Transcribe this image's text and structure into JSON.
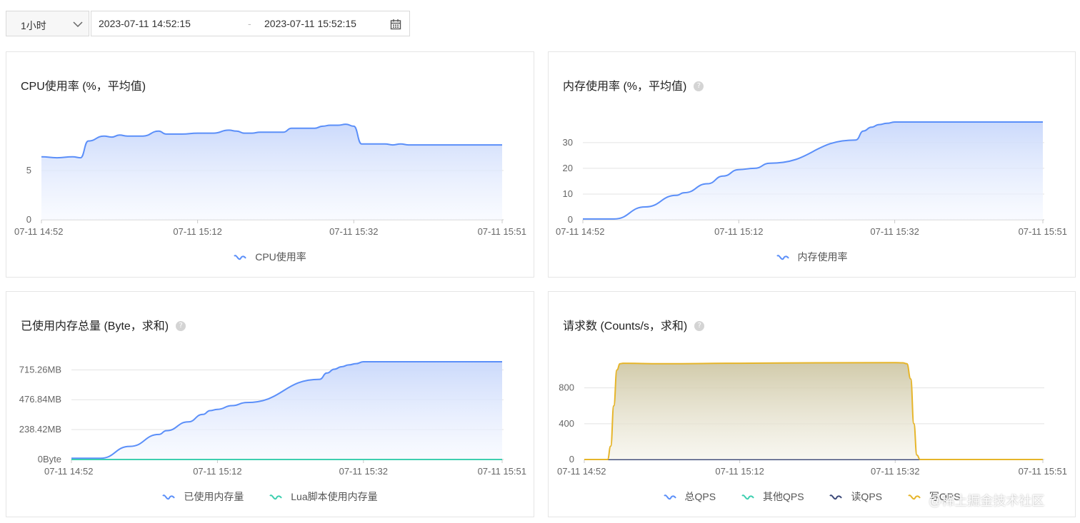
{
  "toolbar": {
    "range_select": {
      "value": "1小时"
    },
    "start_time": "2023-07-11 14:52:15",
    "separator": "-",
    "end_time": "2023-07-11 15:52:15"
  },
  "colors": {
    "blue": "#5b8ff9",
    "teal": "#3ecfb0",
    "navy": "#3d4a7a",
    "gold": "#e6b52a",
    "grid": "#e3e3e3",
    "axis": "#c8c8c8"
  },
  "panels": {
    "cpu": {
      "title": "CPU使用率 (%，平均值)",
      "legend": [
        "CPU使用率"
      ]
    },
    "mem": {
      "title": "内存使用率 (%，平均值)",
      "legend": [
        "内存使用率"
      ]
    },
    "used": {
      "title": "已使用内存总量 (Byte，求和)",
      "legend": [
        "已使用内存量",
        "Lua脚本使用内存量"
      ]
    },
    "qps": {
      "title": "请求数 (Counts/s，求和)",
      "legend": [
        "总QPS",
        "其他QPS",
        "读QPS",
        "写QPS"
      ]
    }
  },
  "chart_data": [
    {
      "id": "cpu",
      "type": "area",
      "x_ticks": [
        "07-11 14:52",
        "07-11 15:12",
        "07-11 15:32",
        "07-11 15:51"
      ],
      "y_ticks": [
        0,
        5
      ],
      "ylim": [
        0,
        10
      ],
      "series": [
        {
          "name": "CPU使用率",
          "x": [
            0,
            2,
            4,
            5,
            6,
            8,
            9,
            10,
            11,
            12,
            13,
            15,
            16,
            17,
            18,
            20,
            22,
            24,
            25,
            26,
            27,
            28,
            29,
            30,
            31,
            32,
            33,
            34,
            35,
            36,
            37,
            38,
            39,
            40,
            41,
            42,
            43,
            44,
            45,
            46,
            47,
            48,
            49,
            50,
            52,
            54,
            55,
            56,
            57,
            58,
            59
          ],
          "y": [
            6.4,
            6.3,
            6.4,
            6.3,
            8.0,
            8.5,
            8.4,
            8.6,
            8.5,
            8.5,
            8.5,
            9.0,
            8.7,
            8.7,
            8.7,
            8.8,
            8.8,
            9.1,
            9.0,
            8.8,
            8.8,
            8.9,
            8.9,
            8.9,
            8.9,
            9.3,
            9.3,
            9.3,
            9.3,
            9.5,
            9.6,
            9.6,
            9.7,
            9.5,
            7.7,
            7.7,
            7.7,
            7.7,
            7.6,
            7.7,
            7.6,
            7.6,
            7.6,
            7.6,
            7.6,
            7.6,
            7.6,
            7.6,
            7.6,
            7.6,
            7.6
          ]
        }
      ]
    },
    {
      "id": "mem",
      "type": "area",
      "x_ticks": [
        "07-11 14:52",
        "07-11 15:12",
        "07-11 15:32",
        "07-11 15:51"
      ],
      "y_ticks": [
        0,
        10,
        20,
        30
      ],
      "ylim": [
        0,
        38
      ],
      "series": [
        {
          "name": "内存使用率",
          "x": [
            0,
            4,
            8,
            12,
            13,
            16,
            18,
            20,
            22,
            24,
            35,
            36,
            37,
            38,
            39,
            40,
            42,
            44,
            59
          ],
          "y": [
            0.3,
            0.3,
            5.0,
            9.5,
            10.5,
            14.0,
            17.0,
            19.5,
            20.0,
            22.0,
            31.0,
            34.5,
            36.0,
            37.0,
            37.5,
            38.0,
            38.0,
            38.0,
            38.0
          ]
        }
      ]
    },
    {
      "id": "used",
      "type": "area",
      "x_ticks": [
        "07-11 14:52",
        "07-11 15:12",
        "07-11 15:32",
        "07-11 15:51"
      ],
      "y_ticks": [
        "0Byte",
        "238.42MB",
        "476.84MB",
        "715.26MB"
      ],
      "y_values_mb": [
        0,
        238.42,
        476.84,
        715.26
      ],
      "ylim_mb": [
        0,
        780
      ],
      "series": [
        {
          "name": "已使用内存量",
          "x": [
            0,
            4,
            8,
            12,
            13,
            16,
            18,
            19,
            20,
            22,
            24,
            34,
            35,
            36,
            37,
            38,
            39,
            40,
            42,
            44,
            59
          ],
          "y": [
            10,
            10,
            105,
            200,
            230,
            300,
            360,
            390,
            400,
            430,
            455,
            640,
            690,
            720,
            740,
            755,
            765,
            780,
            780,
            780,
            780
          ]
        },
        {
          "name": "Lua脚本使用内存量",
          "x": [
            0,
            59
          ],
          "y": [
            0,
            0
          ]
        }
      ]
    },
    {
      "id": "qps",
      "type": "area",
      "x_ticks": [
        "07-11 14:52",
        "07-11 15:12",
        "07-11 15:32",
        "07-11 15:51"
      ],
      "y_ticks": [
        0,
        400,
        800
      ],
      "ylim": [
        0,
        1100
      ],
      "series": [
        {
          "name": "总QPS",
          "x": [
            0,
            59
          ],
          "y": [
            0,
            0
          ]
        },
        {
          "name": "其他QPS",
          "x": [
            0,
            59
          ],
          "y": [
            0,
            0
          ]
        },
        {
          "name": "读QPS",
          "x": [
            0,
            59
          ],
          "y": [
            0,
            0
          ]
        },
        {
          "name": "写QPS",
          "x": [
            0,
            3,
            3.4,
            3.8,
            4.2,
            4.6,
            5,
            10,
            20,
            30,
            40,
            41,
            41.5,
            42,
            42.4,
            42.8,
            43.2,
            45,
            59
          ],
          "y": [
            0,
            0,
            150,
            600,
            1000,
            1070,
            1075,
            1070,
            1075,
            1080,
            1082,
            1080,
            1070,
            900,
            400,
            50,
            0,
            0,
            0
          ]
        }
      ]
    }
  ],
  "watermark": "@稀土掘金技术社区"
}
